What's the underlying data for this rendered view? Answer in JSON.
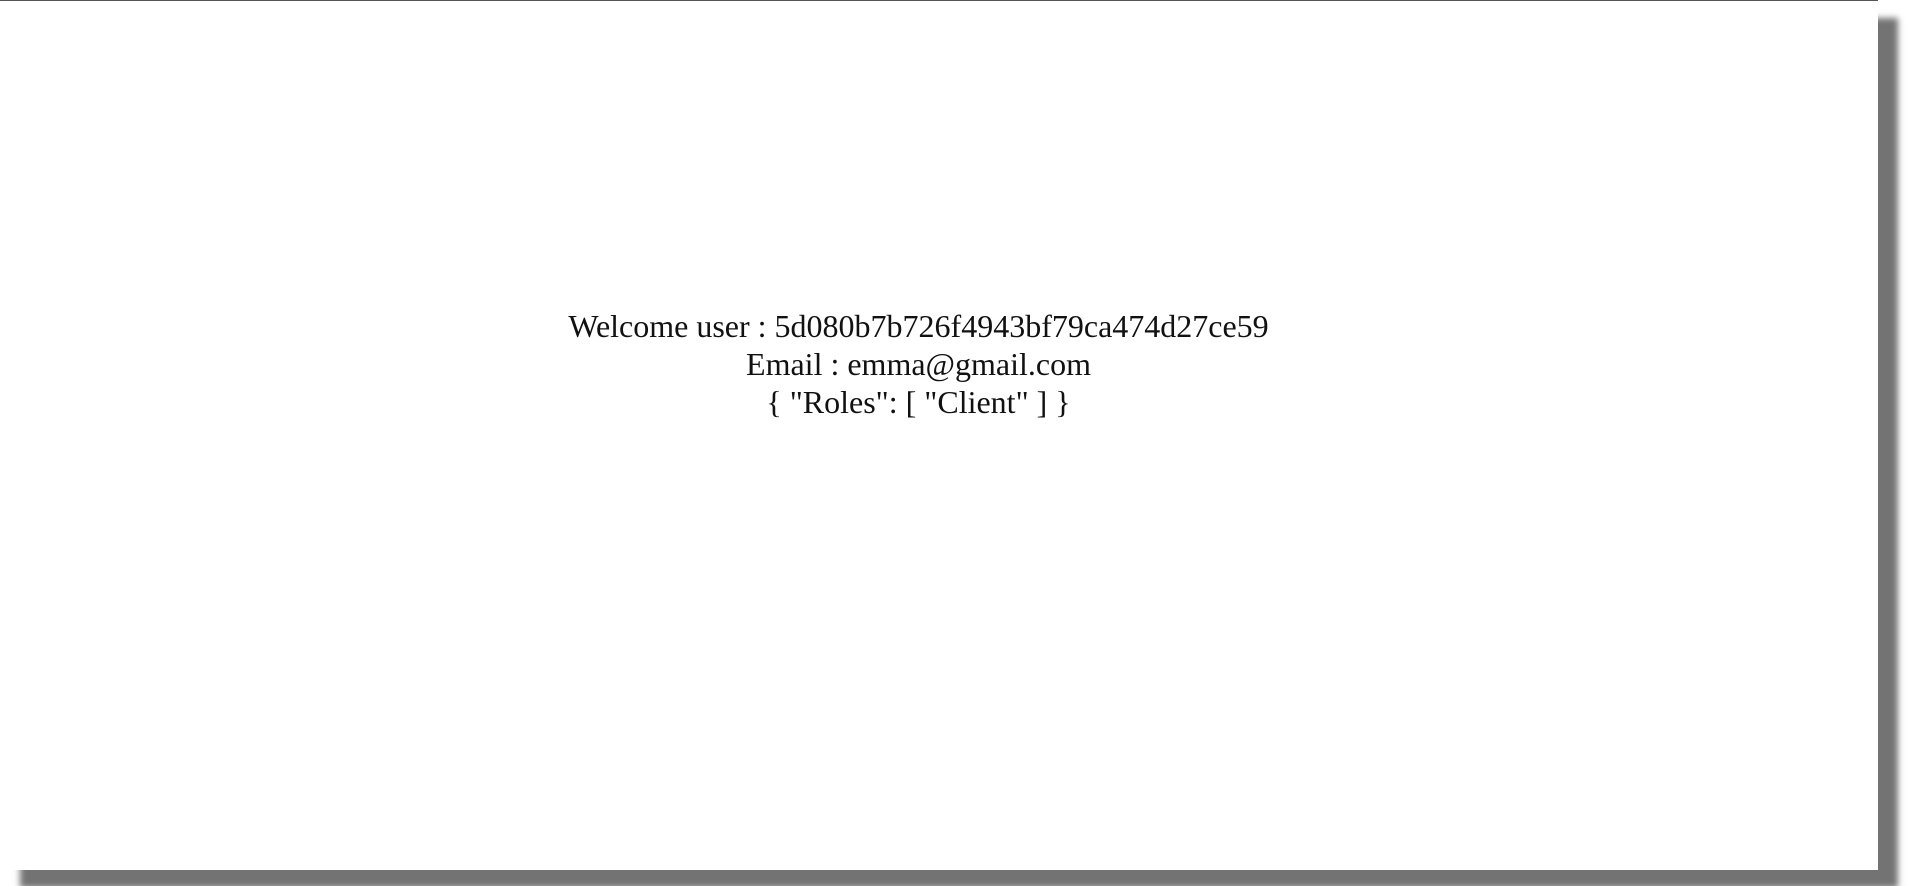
{
  "welcome": {
    "user_line": "Welcome user : 5d080b7b726f4943bf79ca474d27ce59",
    "email_line": "Email : emma@gmail.com",
    "roles_line": "{ \"Roles\": [ \"Client\" ] }"
  }
}
